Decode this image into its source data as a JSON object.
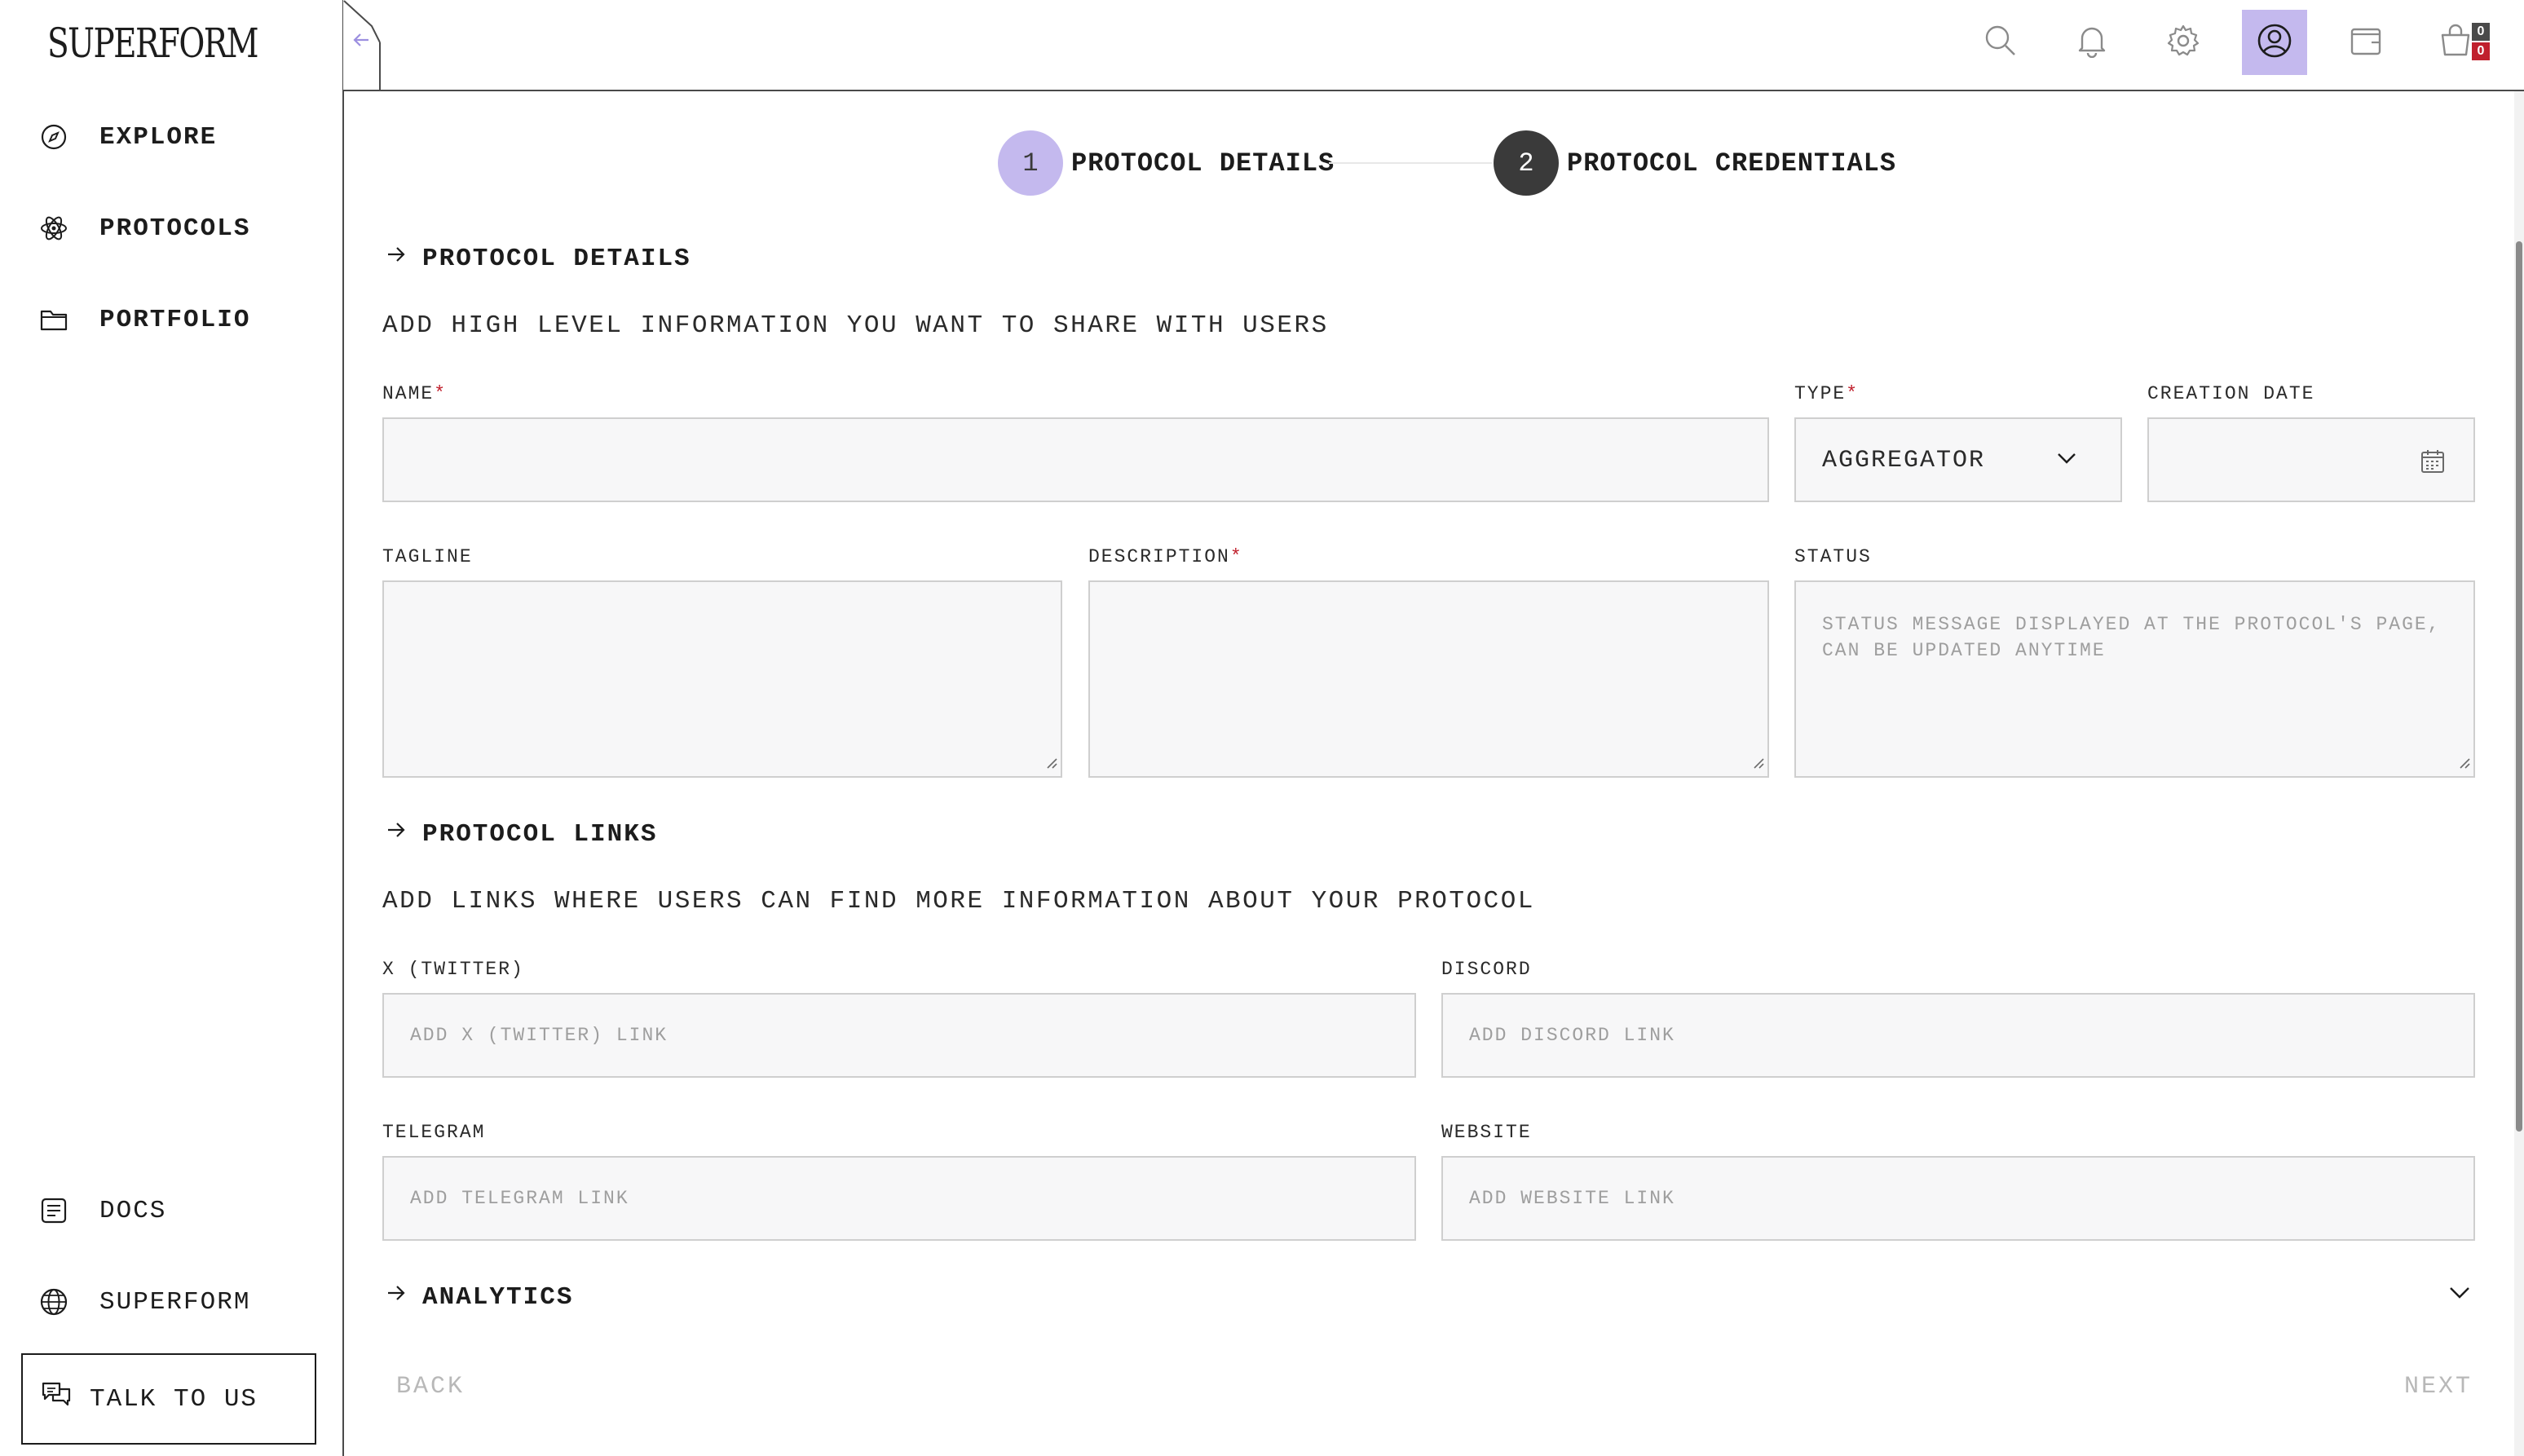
{
  "app": {
    "logo": "SUPERFORM"
  },
  "sidebar": {
    "items": [
      {
        "label": "EXPLORE",
        "icon": "compass-icon"
      },
      {
        "label": "PROTOCOLS",
        "icon": "atom-icon"
      },
      {
        "label": "PORTFOLIO",
        "icon": "folder-icon"
      }
    ],
    "bottom_items": [
      {
        "label": "DOCS",
        "icon": "docs-icon"
      },
      {
        "label": "SUPERFORM",
        "icon": "globe-icon"
      }
    ],
    "talk_label": "TALK TO US"
  },
  "topbar": {
    "icons": [
      "search-icon",
      "bell-icon",
      "gear-icon",
      "user-icon",
      "wallet-icon",
      "cart-icon"
    ],
    "badges": {
      "top": "0",
      "bottom": "0"
    },
    "active_color": "#c4b9ee"
  },
  "stepper": {
    "steps": [
      {
        "num": "1",
        "label": "PROTOCOL DETAILS"
      },
      {
        "num": "2",
        "label": "PROTOCOL CREDENTIALS"
      }
    ]
  },
  "details": {
    "title": "PROTOCOL DETAILS",
    "subtitle": "ADD HIGH LEVEL INFORMATION YOU WANT TO SHARE WITH USERS",
    "name_label": "NAME",
    "type_label": "TYPE",
    "type_value": "AGGREGATOR",
    "creation_label": "CREATION DATE",
    "tagline_label": "TAGLINE",
    "description_label": "DESCRIPTION",
    "status_label": "STATUS",
    "status_placeholder_1": "STATUS MESSAGE DISPLAYED AT THE PROTOCOL'S PAGE,",
    "status_placeholder_2": "CAN BE UPDATED ANYTIME",
    "required_mark": "*"
  },
  "links": {
    "title": "PROTOCOL LINKS",
    "subtitle": "ADD LINKS WHERE USERS CAN FIND MORE INFORMATION ABOUT YOUR PROTOCOL",
    "twitter_label": "X (TWITTER)",
    "twitter_placeholder": "ADD X (TWITTER) LINK",
    "discord_label": "DISCORD",
    "discord_placeholder": "ADD DISCORD LINK",
    "telegram_label": "TELEGRAM",
    "telegram_placeholder": "ADD TELEGRAM LINK",
    "website_label": "WEBSITE",
    "website_placeholder": "ADD WEBSITE LINK"
  },
  "analytics": {
    "title": "ANALYTICS"
  },
  "footer": {
    "back": "BACK",
    "next": "NEXT"
  },
  "colors": {
    "accent": "#c4b9ee",
    "dark_step": "#3a3a3a",
    "required": "#c0202d",
    "badge_red": "#c0202d"
  }
}
